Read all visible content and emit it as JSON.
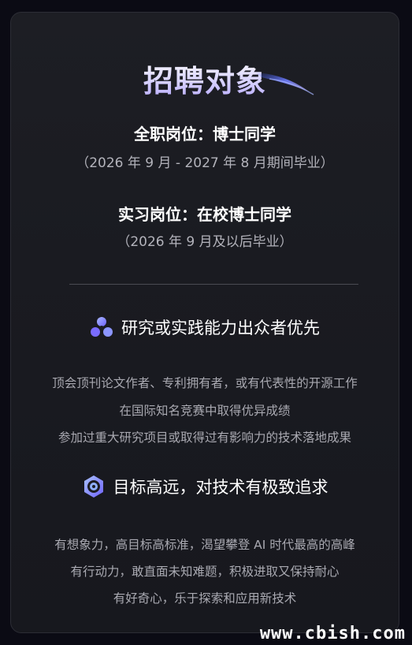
{
  "title": "招聘对象",
  "fulltime": {
    "label": "全职岗位：博士同学",
    "note": "（2026 年 9 月 - 2027 年 8 月期间毕业）"
  },
  "intern": {
    "label": "实习岗位：在校博士同学",
    "note": "（2026 年 9 月及以后毕业）"
  },
  "sections": [
    {
      "icon": "triangle-nodes-icon",
      "heading": "研究或实践能力出众者优先",
      "lines": [
        "顶会顶刊论文作者、专利拥有者，或有代表性的开源工作",
        "在国际知名竞赛中取得优异成绩",
        "参加过重大研究项目或取得过有影响力的技术落地成果"
      ]
    },
    {
      "icon": "target-icon",
      "heading": "目标高远，对技术有极致追求",
      "lines": [
        "有想象力，高目标高标准，渴望攀登 AI 时代最高的高峰",
        "有行动力，敢直面未知难题，积极进取又保持耐心",
        "有好奇心，乐于探索和应用新技术"
      ]
    }
  ],
  "watermark": "www.cbish.com",
  "colors": {
    "background": "#0b0b14",
    "card": "#1c1d23",
    "title_gradient_end": "#b6a9ff",
    "icon_purple": "#6f63ff",
    "icon_blue": "#8fb0ff"
  }
}
